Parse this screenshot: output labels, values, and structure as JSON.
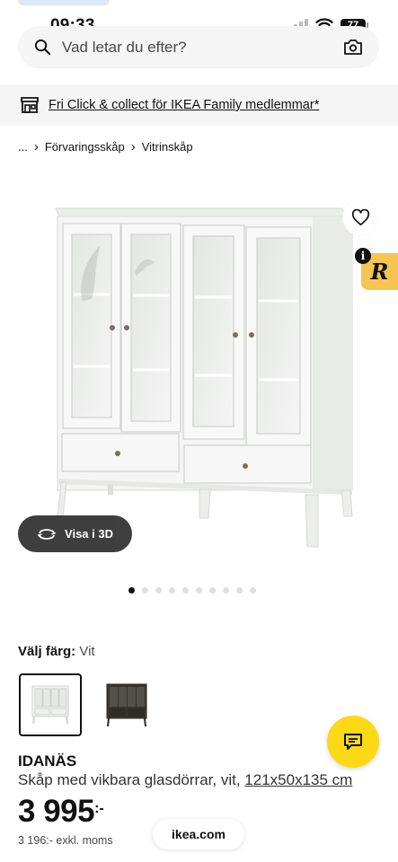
{
  "status_bar": {
    "time": "09:33",
    "battery": "77"
  },
  "search": {
    "placeholder": "Vad letar du efter?"
  },
  "promo": {
    "text": "Fri Click & collect för IKEA Family medlemmar*"
  },
  "breadcrumb": {
    "ellipsis": "...",
    "items": [
      "Förvaringsskåp",
      "Vitrinskåp"
    ]
  },
  "gallery": {
    "view_3d_label": "Visa i 3D",
    "dot_count": 10,
    "active_index": 0
  },
  "extension": {
    "letter": "R",
    "info": "i"
  },
  "color": {
    "label": "Välj färg:",
    "value": "Vit",
    "options": [
      "white",
      "black-brown"
    ],
    "selected": "white"
  },
  "product": {
    "name": "IDANÄS",
    "description": "Skåp med vikbara glasdörrar, vit,",
    "dimensions": "121x50x135 cm",
    "price": "3 995",
    "price_suffix": ":-",
    "price_ex_vat": "3 196:- exkl. moms"
  },
  "browser": {
    "domain": "ikea.com"
  },
  "colors": {
    "chat": "#fbd914",
    "extension": "#f5c451",
    "text": "#111111"
  },
  "icons": [
    "search-icon",
    "camera-icon",
    "store-icon",
    "heart-icon",
    "rotate-3d-icon",
    "chat-icon",
    "wifi-icon",
    "signal-icon",
    "battery-icon"
  ]
}
